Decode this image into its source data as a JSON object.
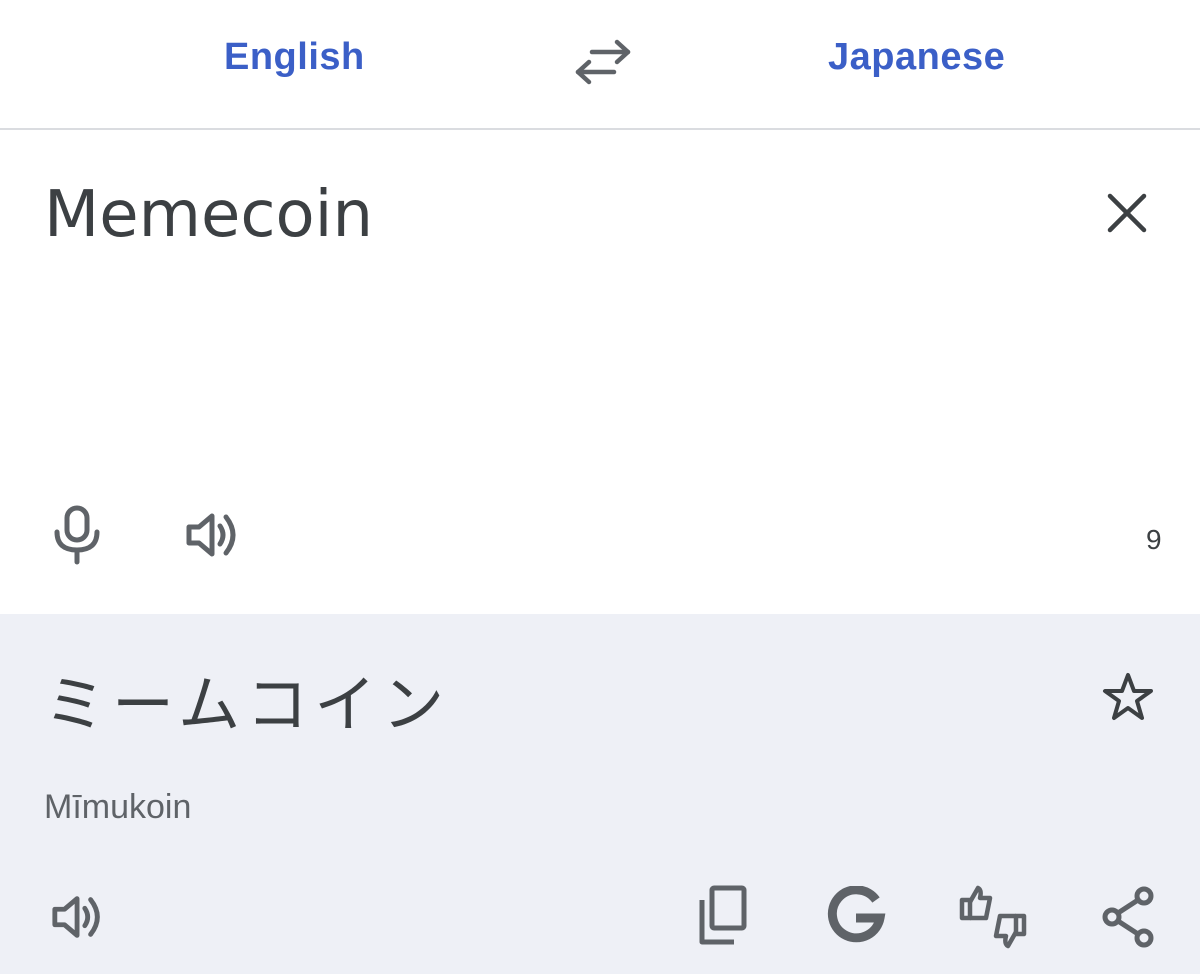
{
  "header": {
    "source_language": "English",
    "target_language": "Japanese",
    "swap_icon": "swap-arrows-icon"
  },
  "input": {
    "text": "Memecoin",
    "char_count": "9",
    "icons": [
      "close-icon",
      "microphone-icon",
      "speaker-icon"
    ]
  },
  "output": {
    "translation": "ミームコイン",
    "romanization": "Mīmukoin",
    "icons": [
      "star-icon",
      "speaker-icon",
      "copy-icon",
      "google-icon",
      "feedback-icon",
      "share-icon"
    ]
  },
  "colors": {
    "accent": "#3b5fc7",
    "text": "#3c4043",
    "output_bg": "#eef0f6",
    "icon": "#5f6368"
  }
}
